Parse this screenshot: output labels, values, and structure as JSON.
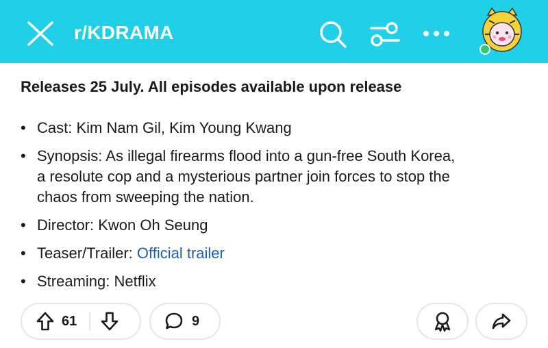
{
  "header": {
    "subreddit": "r/KDRAMA",
    "background": "#1fd0e8",
    "icons": [
      "close-icon",
      "search-icon",
      "filter-icon",
      "more-icon",
      "avatar"
    ]
  },
  "post": {
    "headline": "Releases 25 July. All episodes available upon release",
    "items": [
      {
        "label": "Cast: Kim Nam Gil, Kim Young Kwang"
      },
      {
        "label": "Synopsis: As illegal firearms flood into a gun-free South Korea,",
        "label2": "a resolute cop and a mysterious partner join forces to stop the",
        "label3": "chaos from sweeping the nation."
      },
      {
        "label": "Director: Kwon Oh Seung"
      },
      {
        "label": "Teaser/Trailer: ",
        "link": "Official trailer"
      },
      {
        "label": "Streaming: Netflix"
      }
    ]
  },
  "actions": {
    "upvotes": "61",
    "comments": "9",
    "icons": [
      "upvote-icon",
      "downvote-icon",
      "comment-icon",
      "award-icon",
      "share-icon"
    ]
  },
  "colors": {
    "link": "#1a5fb4",
    "accent": "#1fd0e8",
    "online": "#2ecc71"
  }
}
